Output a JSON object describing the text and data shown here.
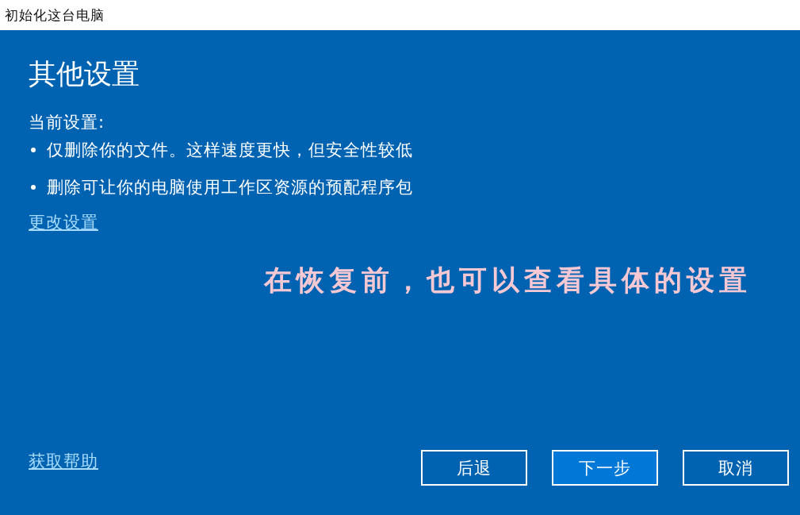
{
  "window": {
    "title": "初始化这台电脑"
  },
  "heading": "其他设置",
  "current_settings": {
    "label": "当前设置:",
    "items": [
      "仅删除你的文件。这样速度更快，但安全性较低",
      "删除可让你的电脑使用工作区资源的预配程序包"
    ]
  },
  "change_link": "更改设置",
  "annotation": "在恢复前，也可以查看具体的设置",
  "help_link": "获取帮助",
  "buttons": [
    {
      "label": "后退",
      "default": false
    },
    {
      "label": "下一步",
      "default": true
    },
    {
      "label": "取消",
      "default": false
    }
  ]
}
